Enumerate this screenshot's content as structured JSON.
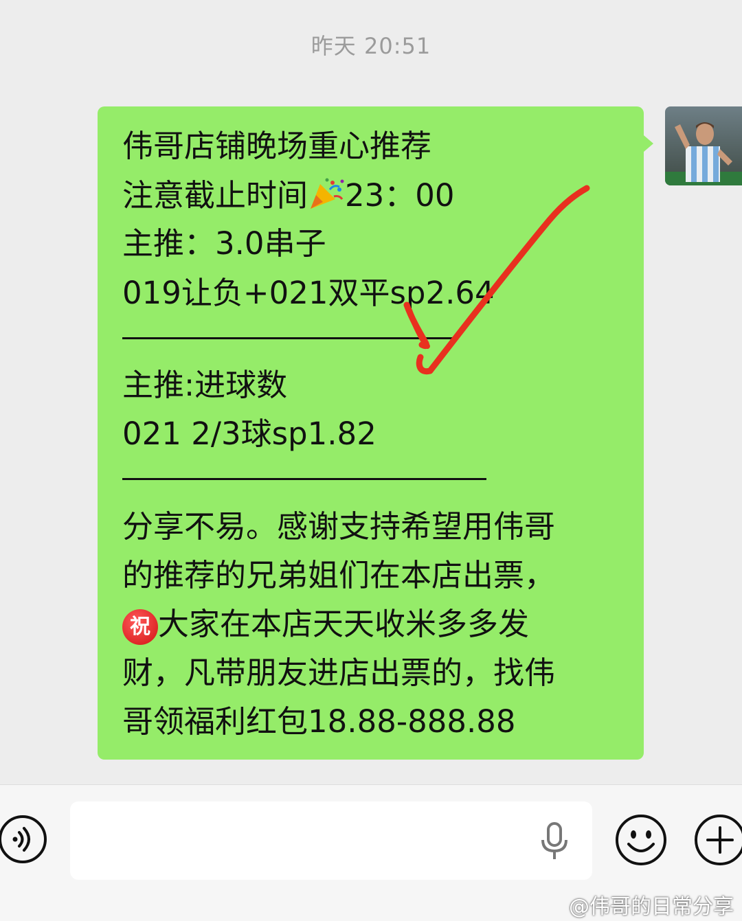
{
  "chat": {
    "timestamp": "昨天 20:51"
  },
  "message": {
    "line1": "伟哥店铺晚场重心推荐",
    "line2_prefix": "注意截止时间",
    "line2_emoji": "party-popper-emoji",
    "line2_suffix": "23：00",
    "line3": "主推：3.0串子",
    "line4": "019让负+021双平sp2.64",
    "line5": "主推:进球数",
    "line6": "021   2/3球sp1.82",
    "line7": "分享不易。感谢支持希望用伟哥",
    "line8": "的推荐的兄弟姐们在本店出票，",
    "line9_emoji": "祝",
    "line9_suffix": "大家在本店天天收米多多发",
    "line10": "财，凡带朋友进店出票的，找伟",
    "line11": "哥领福利红包18.88-888.88"
  },
  "annotation": {
    "icon": "red-checkmark-icon",
    "color": "#e8301f"
  },
  "bottom_bar": {
    "voice_icon": "voice-icon",
    "mic_icon": "microphone-icon",
    "emoji_icon": "emoji-icon",
    "plus_icon": "plus-icon"
  },
  "watermark": {
    "text": "@伟哥的日常分享"
  },
  "colors": {
    "bubble": "#95ec69",
    "background": "#ededed"
  }
}
